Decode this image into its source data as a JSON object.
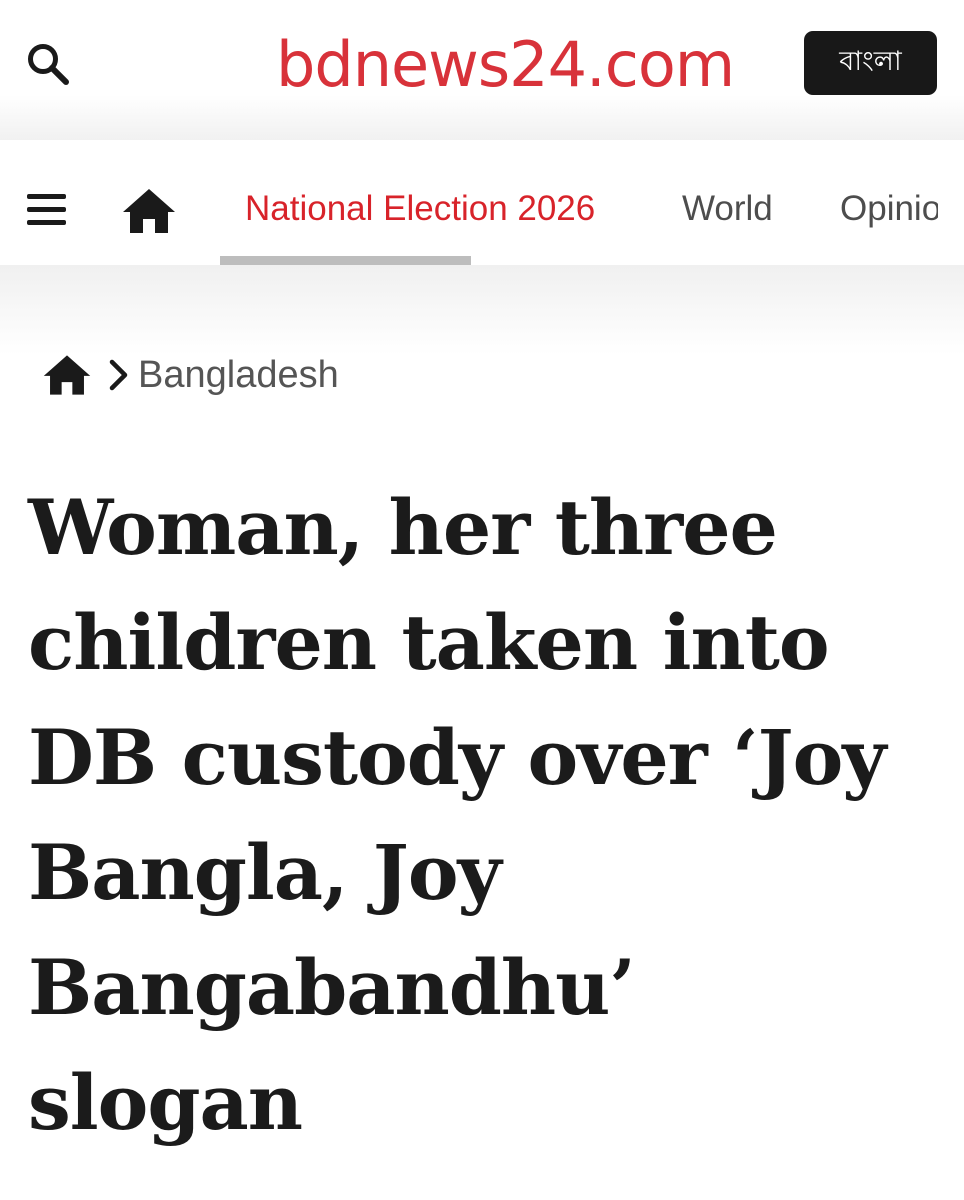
{
  "header": {
    "logo": "bdnews24.com",
    "language_button": "বাংলা",
    "search_icon": "search-icon",
    "brand_color": "#d8323a"
  },
  "nav": {
    "menu_icon": "hamburger-menu-icon",
    "home_icon": "home-icon",
    "items": [
      {
        "label": "National Election 2026",
        "active": true
      },
      {
        "label": "World",
        "active": false
      },
      {
        "label": "Opinion",
        "active": false
      }
    ],
    "active_color": "#d8232a"
  },
  "breadcrumb": {
    "home_icon": "home-icon",
    "separator_icon": "chevron-right-icon",
    "section": "Bangladesh"
  },
  "article": {
    "headline_lines": [
      "Woman, her three",
      "children taken into",
      "DB custody over ‘Joy",
      "Bangla, Joy",
      "Bangabandhu’",
      "slogan"
    ]
  }
}
